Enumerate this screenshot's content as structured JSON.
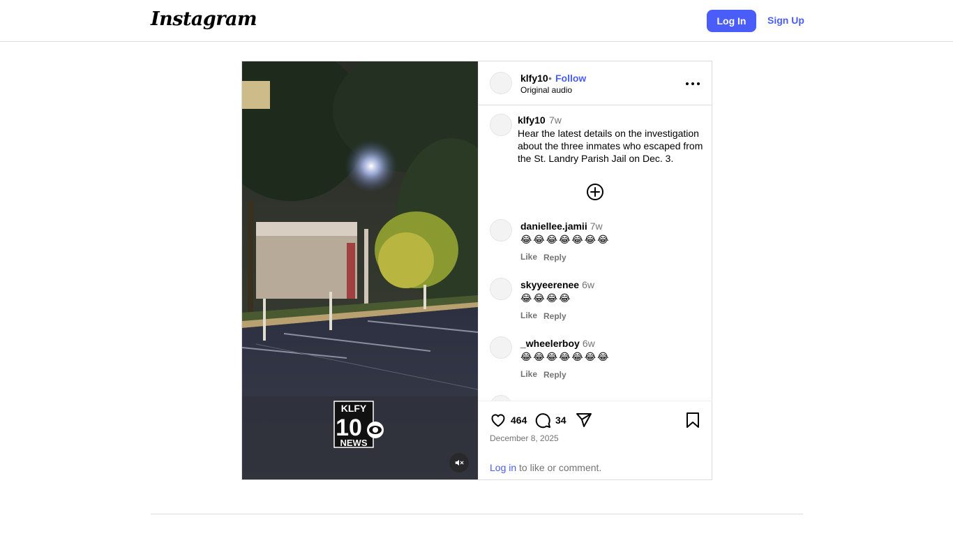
{
  "nav": {
    "logo": "Instagram",
    "login_label": "Log In",
    "signup_label": "Sign Up"
  },
  "video": {
    "logo_line1": "KLFY",
    "logo_line2": "10",
    "logo_line3": "NEWS"
  },
  "post": {
    "author": "klfy10",
    "dot": "•",
    "follow_label": "Follow",
    "audio": "Original audio",
    "caption_user": "klfy10",
    "caption_time": "7w",
    "caption_text": "Hear the latest details on the investigation about the three inmates who escaped from the St. Landry Parish Jail on Dec. 3.",
    "likes": "464",
    "comment_count": "34",
    "date": "December 8, 2025",
    "login_link": "Log in",
    "login_suffix": " to like or comment."
  },
  "comments": [
    {
      "user": "daniellee.jamii",
      "time": "7w",
      "text": "😂😂😂😂😂😂😂",
      "like": "Like",
      "reply": "Reply"
    },
    {
      "user": "skyyeerenee",
      "time": "6w",
      "text": "😂😂😂😂",
      "like": "Like",
      "reply": "Reply"
    },
    {
      "user": "_wheelerboy",
      "time": "6w",
      "text": "😂😂😂😂😂😂😂",
      "like": "Like",
      "reply": "Reply"
    }
  ],
  "icons": {
    "more": "more-options-icon",
    "add_comment": "add-circle-icon",
    "like": "heart-icon",
    "comment": "comment-bubble-icon",
    "share": "paper-plane-icon",
    "save": "bookmark-icon",
    "mute": "speaker-muted-icon"
  },
  "colors": {
    "accent": "#4a5df9",
    "muted_text": "#737373",
    "border": "#dbdbdb"
  }
}
